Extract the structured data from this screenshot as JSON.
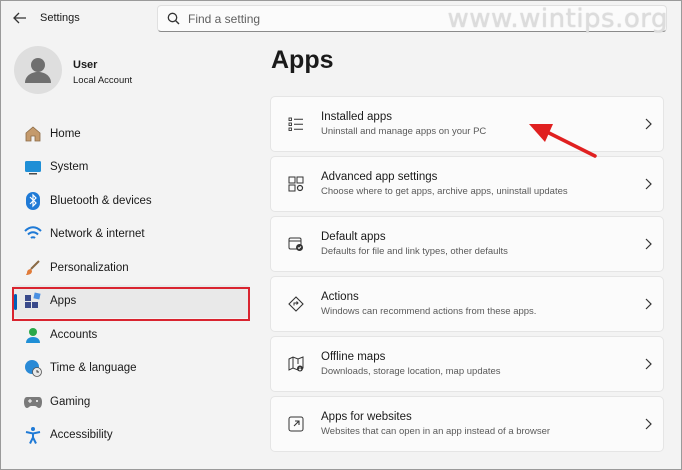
{
  "window": {
    "title": "Settings"
  },
  "watermark": "www.wintips.org",
  "search": {
    "placeholder": "Find a setting"
  },
  "user": {
    "name": "User",
    "account_type": "Local Account"
  },
  "nav": {
    "items": [
      {
        "label": "Home",
        "icon": "home-icon"
      },
      {
        "label": "System",
        "icon": "system-icon"
      },
      {
        "label": "Bluetooth & devices",
        "icon": "bluetooth-icon"
      },
      {
        "label": "Network & internet",
        "icon": "network-icon"
      },
      {
        "label": "Personalization",
        "icon": "brush-icon"
      },
      {
        "label": "Apps",
        "icon": "apps-icon",
        "active": true
      },
      {
        "label": "Accounts",
        "icon": "accounts-icon"
      },
      {
        "label": "Time & language",
        "icon": "globe-clock-icon"
      },
      {
        "label": "Gaming",
        "icon": "gamepad-icon"
      },
      {
        "label": "Accessibility",
        "icon": "accessibility-icon"
      }
    ]
  },
  "main": {
    "title": "Apps",
    "cards": [
      {
        "title": "Installed apps",
        "subtitle": "Uninstall and manage apps on your PC",
        "icon": "list-icon"
      },
      {
        "title": "Advanced app settings",
        "subtitle": "Choose where to get apps, archive apps, uninstall updates",
        "icon": "app-settings-icon"
      },
      {
        "title": "Default apps",
        "subtitle": "Defaults for file and link types, other defaults",
        "icon": "default-apps-icon"
      },
      {
        "title": "Actions",
        "subtitle": "Windows can recommend actions from these apps.",
        "icon": "actions-icon"
      },
      {
        "title": "Offline maps",
        "subtitle": "Downloads, storage location, map updates",
        "icon": "map-icon"
      },
      {
        "title": "Apps for websites",
        "subtitle": "Websites that can open in an app instead of a browser",
        "icon": "open-link-icon"
      }
    ]
  },
  "colors": {
    "accent": "#005fb8",
    "highlight": "#d9242f"
  }
}
